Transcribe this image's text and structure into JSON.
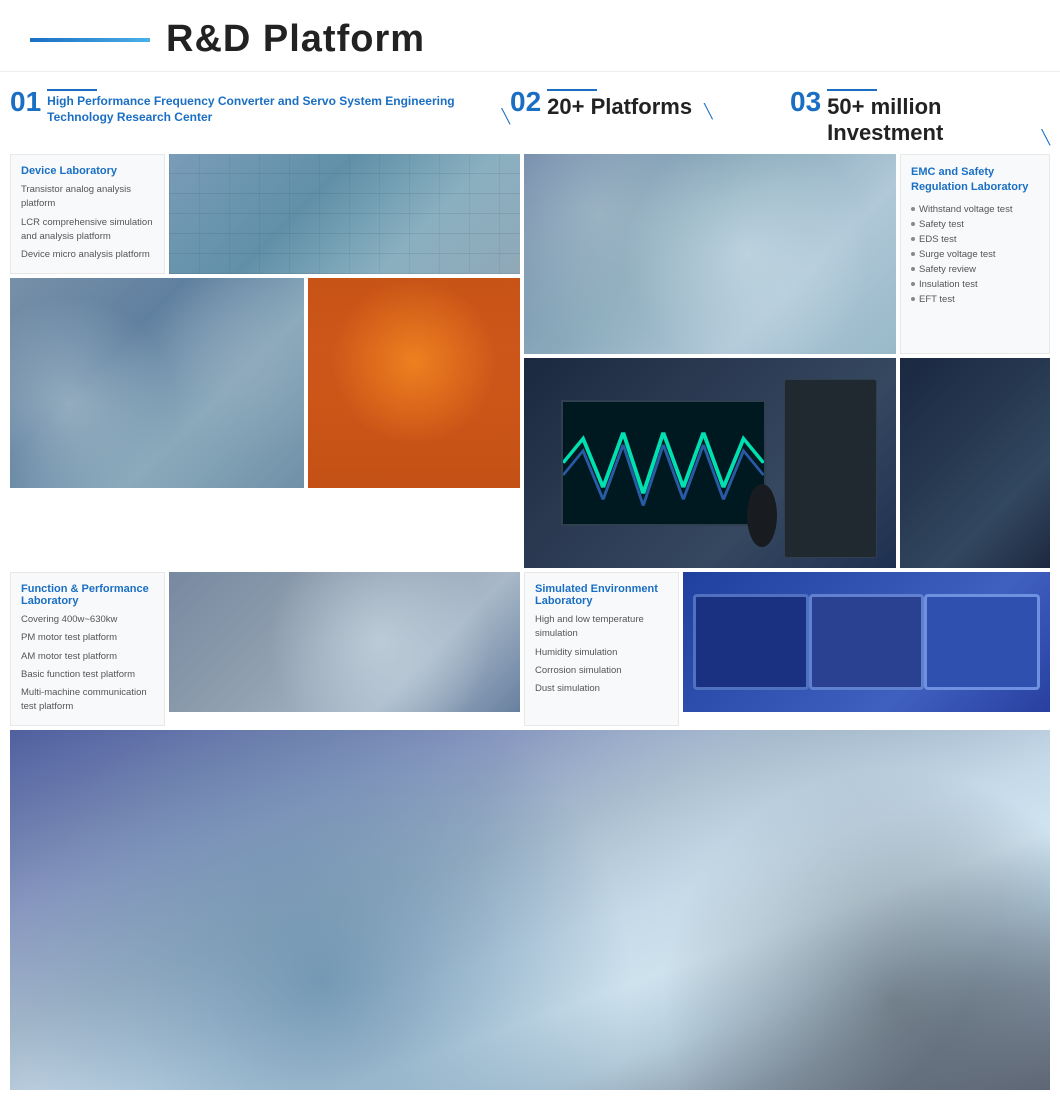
{
  "header": {
    "title": "R&D Platform",
    "line_color": "#1a6fc4"
  },
  "sub_header": {
    "item1": {
      "num": "01",
      "label": "High Performance Frequency Converter and Servo System Engineering Technology Research Center"
    },
    "item2": {
      "num": "02",
      "label": "20+ Platforms"
    },
    "item3": {
      "num": "03",
      "label": "50+ million Investment"
    }
  },
  "device_lab": {
    "title": "Device Laboratory",
    "items": [
      "Transistor analog analysis platform",
      "LCR comprehensive simulation and analysis platform",
      "Device micro analysis platform"
    ]
  },
  "emc_lab": {
    "title": "EMC and Safety Regulation Laboratory",
    "items": [
      "Withstand voltage test",
      "Safety test",
      "EDS test",
      "Surge voltage test",
      "Safety review",
      "Insulation test",
      "EFT test"
    ]
  },
  "func_lab": {
    "title": "Function & Performance Laboratory",
    "items": [
      "Covering 400w~630kw",
      "PM motor test platform",
      "AM motor test platform",
      "Basic function test platform",
      "Multi-machine communication test platform"
    ]
  },
  "sim_env_lab": {
    "title": "Simulated Environment Laboratory",
    "items": [
      "High and low temperature simulation",
      "Humidity simulation",
      "Corrosion simulation",
      "Dust simulation"
    ]
  }
}
